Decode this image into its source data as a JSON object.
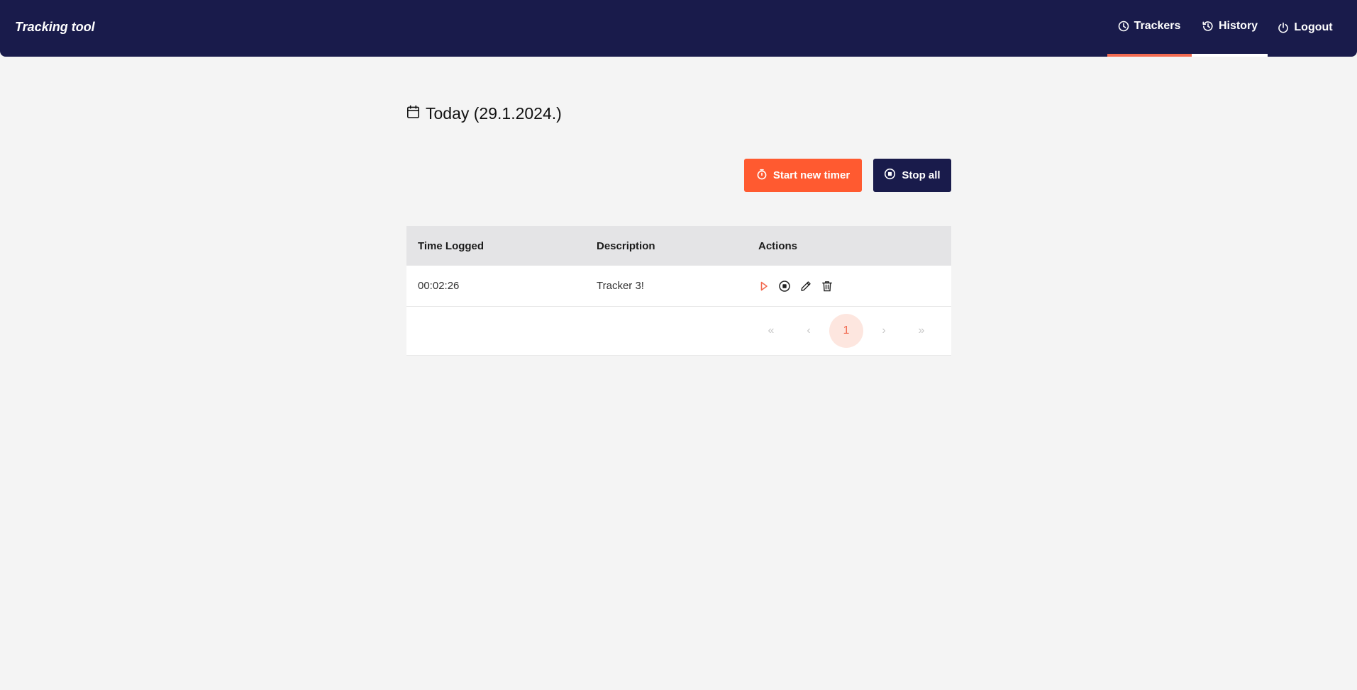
{
  "header": {
    "brand": "Tracking tool",
    "nav": [
      {
        "label": "Trackers",
        "icon": "clock-icon",
        "active": true
      },
      {
        "label": "History",
        "icon": "history-icon",
        "active": false
      },
      {
        "label": "Logout",
        "icon": "power-icon",
        "active": false
      }
    ]
  },
  "main": {
    "title": "Today (29.1.2024.)",
    "title_icon": "calendar-icon",
    "start_button": "Start new timer",
    "stop_button": "Stop all"
  },
  "table": {
    "columns": [
      "Time Logged",
      "Description",
      "Actions"
    ],
    "rows": [
      {
        "time": "00:02:26",
        "description": "Tracker 3!",
        "actions": [
          "play-icon",
          "stop-icon",
          "edit-icon",
          "delete-icon"
        ]
      }
    ]
  },
  "pagination": {
    "first": "«",
    "prev": "‹",
    "current_page": "1",
    "next": "›",
    "last": "»"
  },
  "colors": {
    "header_bg": "#191b4b",
    "accent": "#ff5a30",
    "page_bg": "#f4f4f4"
  }
}
